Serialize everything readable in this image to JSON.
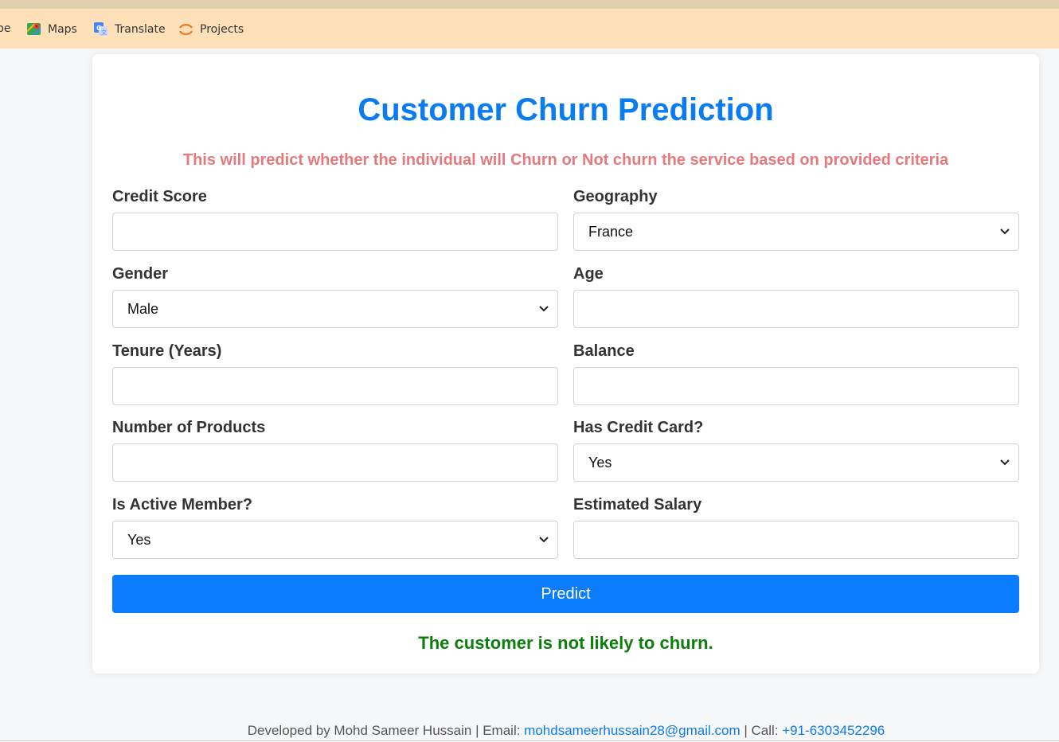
{
  "bookmarks": {
    "cut_label": "pe",
    "items": [
      {
        "label": "Maps",
        "icon": "maps-icon"
      },
      {
        "label": "Translate",
        "icon": "translate-icon"
      },
      {
        "label": "Projects",
        "icon": "projects-icon"
      }
    ]
  },
  "form": {
    "title": "Customer Churn Prediction",
    "subtitle": "This will predict whether the individual will Churn or Not churn the service based on provided criteria",
    "fields": {
      "credit_score": {
        "label": "Credit Score",
        "value": ""
      },
      "geography": {
        "label": "Geography",
        "value": "France"
      },
      "gender": {
        "label": "Gender",
        "value": "Male"
      },
      "age": {
        "label": "Age",
        "value": ""
      },
      "tenure": {
        "label": "Tenure (Years)",
        "value": ""
      },
      "balance": {
        "label": "Balance",
        "value": ""
      },
      "num_products": {
        "label": "Number of Products",
        "value": ""
      },
      "has_credit_card": {
        "label": "Has Credit Card?",
        "value": "Yes"
      },
      "is_active_member": {
        "label": "Is Active Member?",
        "value": "Yes"
      },
      "estimated_salary": {
        "label": "Estimated Salary",
        "value": ""
      }
    },
    "predict_label": "Predict",
    "result": "The customer is not likely to churn."
  },
  "footer": {
    "prefix": "Developed by Mohd Sameer Hussain | Email: ",
    "email": "mohdsameerhussain28@gmail.com",
    "middle": " | Call: ",
    "phone": "+91-6303452296"
  },
  "colors": {
    "accent": "#0b7cef",
    "button": "#0b7cfe",
    "subtitle": "#e57a7e",
    "result": "#0b7e0b",
    "bookmark_bar": "#fee0b9"
  }
}
